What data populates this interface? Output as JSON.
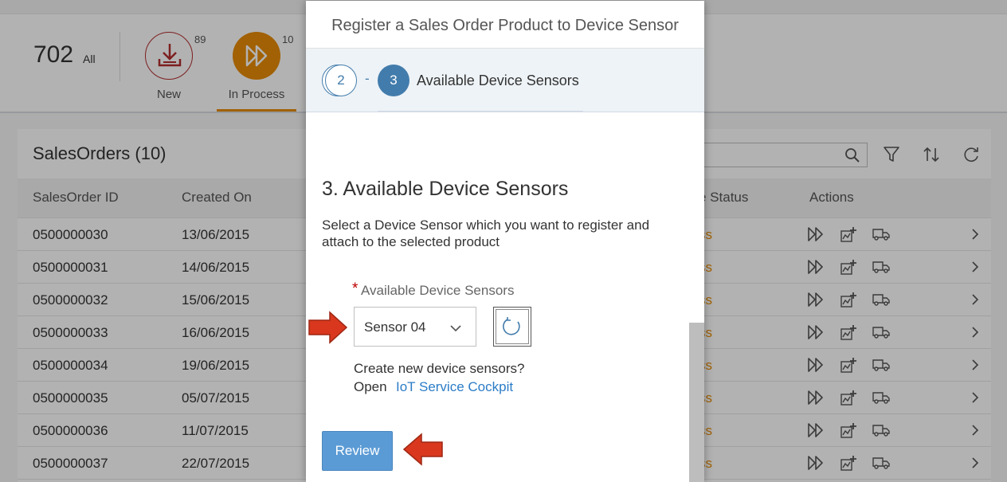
{
  "header": {
    "total_count": "702",
    "total_label": "All",
    "tabs": [
      {
        "label": "New",
        "count": "89"
      },
      {
        "label": "In Process",
        "count": "10"
      }
    ]
  },
  "table": {
    "title": "SalesOrders (10)",
    "columns": [
      "SalesOrder ID",
      "Created On",
      "e Status",
      "Actions"
    ],
    "rows": [
      {
        "id": "0500000030",
        "date": "13/06/2015",
        "status": "ss"
      },
      {
        "id": "0500000031",
        "date": "14/06/2015",
        "status": "ss"
      },
      {
        "id": "0500000032",
        "date": "15/06/2015",
        "status": "ss"
      },
      {
        "id": "0500000033",
        "date": "16/06/2015",
        "status": "ss"
      },
      {
        "id": "0500000034",
        "date": "19/06/2015",
        "status": "ss"
      },
      {
        "id": "0500000035",
        "date": "05/07/2015",
        "status": "ss"
      },
      {
        "id": "0500000036",
        "date": "11/07/2015",
        "status": "ss"
      },
      {
        "id": "0500000037",
        "date": "22/07/2015",
        "status": "ss"
      }
    ]
  },
  "dialog": {
    "title": "Register a Sales Order Product to Device Sensor",
    "wizard": {
      "prev_step": "2",
      "separator": "-",
      "current_step": "3",
      "current_label": "Available Device Sensors"
    },
    "section_title": "3. Available Device Sensors",
    "section_desc": "Select a Device Sensor which you want to register and attach to the selected product",
    "field": {
      "required_mark": "*",
      "label": "Available Device Sensors",
      "selected_value": "Sensor 04"
    },
    "create_question": "Create new device sensors?",
    "open_label": "Open",
    "link_label": "IoT Service Cockpit",
    "review_label": "Review"
  },
  "colors": {
    "accent": "#427cac",
    "in_process": "#e78c07",
    "new": "#b32d2e",
    "link": "#2b7cc7",
    "review_button": "#5b9bd5",
    "annotation_arrow": "#d9381e"
  },
  "icons": [
    "download-icon",
    "forward-icon",
    "search-icon",
    "filter-icon",
    "sort-icon",
    "refresh-icon",
    "chart-add-icon",
    "truck-icon",
    "chevron-right-icon",
    "chevron-down-icon"
  ]
}
